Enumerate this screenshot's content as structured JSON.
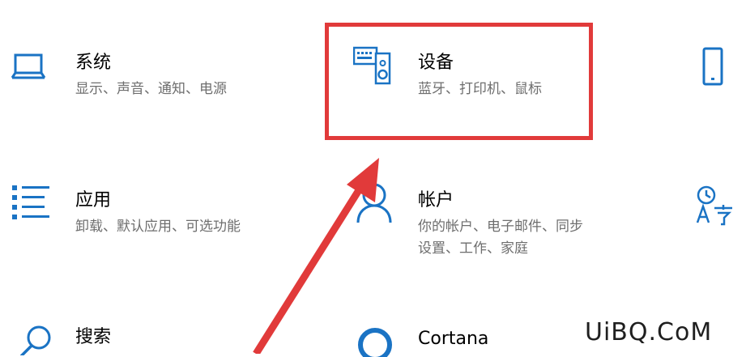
{
  "accent_color": "#1a73c4",
  "highlight_color": "#e13a3a",
  "tiles": [
    {
      "id": "system",
      "icon": "laptop-icon",
      "title": "系统",
      "desc": [
        "显示、声音、通知、电源"
      ]
    },
    {
      "id": "devices",
      "icon": "keyboard-speaker-icon",
      "title": "设备",
      "desc": [
        "蓝牙、打印机、鼠标"
      ]
    },
    {
      "id": "phone",
      "icon": "phone-icon",
      "title": "",
      "desc": []
    },
    {
      "id": "apps",
      "icon": "app-list-icon",
      "title": "应用",
      "desc": [
        "卸载、默认应用、可选功能"
      ]
    },
    {
      "id": "accounts",
      "icon": "person-icon",
      "title": "帐户",
      "desc": [
        "你的帐户、电子邮件、同步",
        "设置、工作、家庭"
      ]
    },
    {
      "id": "time-language",
      "icon": "time-language-icon",
      "title": "",
      "desc": []
    },
    {
      "id": "search",
      "icon": "search-icon",
      "title": "搜索",
      "desc": []
    },
    {
      "id": "cortana",
      "icon": "cortana-icon",
      "title": "Cortana",
      "desc": []
    }
  ],
  "watermark": "UiBQ.CoM"
}
